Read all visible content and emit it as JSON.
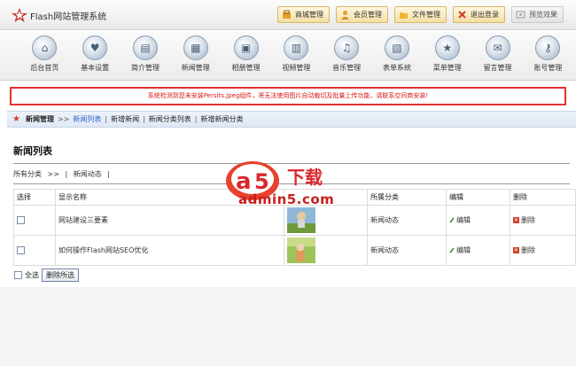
{
  "app": {
    "title": "Flash网站管理系统",
    "top_buttons": [
      {
        "label": "商城管理",
        "icon": "shop-icon"
      },
      {
        "label": "会员管理",
        "icon": "member-icon"
      },
      {
        "label": "文件管理",
        "icon": "folder-icon"
      },
      {
        "label": "退出登录",
        "icon": "logout-icon"
      },
      {
        "label": "预览效果",
        "icon": "preview-icon"
      }
    ]
  },
  "nav": {
    "items": [
      {
        "label": "后台首页",
        "icon": "home-icon",
        "glyph": "⌂"
      },
      {
        "label": "基本设置",
        "icon": "heart-icon",
        "glyph": "♥"
      },
      {
        "label": "简介管理",
        "icon": "document-icon",
        "glyph": "▤"
      },
      {
        "label": "新闻管理",
        "icon": "news-icon",
        "glyph": "▦"
      },
      {
        "label": "相册管理",
        "icon": "album-icon",
        "glyph": "▣"
      },
      {
        "label": "视频管理",
        "icon": "video-icon",
        "glyph": "▥"
      },
      {
        "label": "音乐管理",
        "icon": "music-icon",
        "glyph": "♫"
      },
      {
        "label": "表单系统",
        "icon": "form-icon",
        "glyph": "▧"
      },
      {
        "label": "菜单管理",
        "icon": "star-icon",
        "glyph": "★"
      },
      {
        "label": "留言管理",
        "icon": "message-icon",
        "glyph": "✉"
      },
      {
        "label": "账号管理",
        "icon": "key-icon",
        "glyph": "⚷"
      }
    ]
  },
  "alert": {
    "text": "系统检测到您未安装Persits.Jpeg组件，将无法使用图片自动裁切及批量上传功能，请联系空间商安装!"
  },
  "breadcrumb": {
    "home": "新闻管理",
    "arrow": ">>",
    "current": "新闻列表",
    "links": [
      "新增新闻",
      "新闻分类列表",
      "新增新闻分类"
    ],
    "separator": "|"
  },
  "main": {
    "title": "新闻列表",
    "category_path": [
      "所有分类",
      ">>",
      "|",
      "新闻动态",
      "|"
    ],
    "table": {
      "headers": [
        "选择",
        "显示名称",
        "",
        "所属分类",
        "编辑",
        "删除"
      ],
      "rows": [
        {
          "name": "网站建设三要素",
          "category": "新闻动态",
          "edit": "编辑",
          "delete": "删除"
        },
        {
          "name": "如何操作Flash网站SEO优化",
          "category": "新闻动态",
          "edit": "编辑",
          "delete": "删除"
        }
      ]
    },
    "select_all": "全选",
    "delete_selected": "删除所选"
  },
  "watermark": {
    "title": "下载",
    "url": "admin5.com"
  },
  "colors": {
    "alert_red": "#e23232",
    "link_blue": "#2a66c8",
    "crumb_bg": "#e6edf7"
  }
}
